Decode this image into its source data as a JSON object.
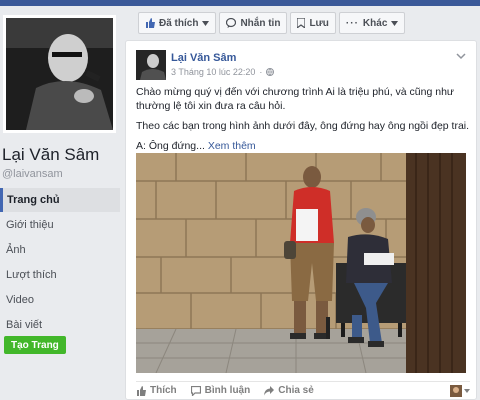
{
  "colors": {
    "brand": "#3b5998",
    "link": "#365899",
    "create": "#42b72a"
  },
  "left": {
    "page_name": "Lại Văn Sâm",
    "handle": "@laivansam",
    "nav": [
      {
        "label": "Trang chủ",
        "active": true
      },
      {
        "label": "Giới thiệu",
        "active": false
      },
      {
        "label": "Ảnh",
        "active": false
      },
      {
        "label": "Lượt thích",
        "active": false
      },
      {
        "label": "Video",
        "active": false
      },
      {
        "label": "Bài viết",
        "active": false
      }
    ],
    "create_label": "Tạo Trang"
  },
  "actions": {
    "liked_label": "Đã thích",
    "message_label": "Nhắn tin",
    "save_label": "Lưu",
    "more_label": "Khác"
  },
  "post": {
    "author": "Lại Văn Sâm",
    "timestamp": "3 Tháng 10 lúc 22:20",
    "line1": "Chào mừng quý vị đến với chương trình Ai là triệu phú, và cũng như thường lệ tôi xin đưa ra câu hỏi.",
    "line2": "Theo các bạn trong hình ảnh dưới đây, ông đứng hay ông ngồi đẹp trai.",
    "answer_prefix": "A: Ông đứng...",
    "see_more": "Xem thêm",
    "like_label": "Thích",
    "comment_label": "Bình luận",
    "share_label": "Chia sẻ"
  }
}
